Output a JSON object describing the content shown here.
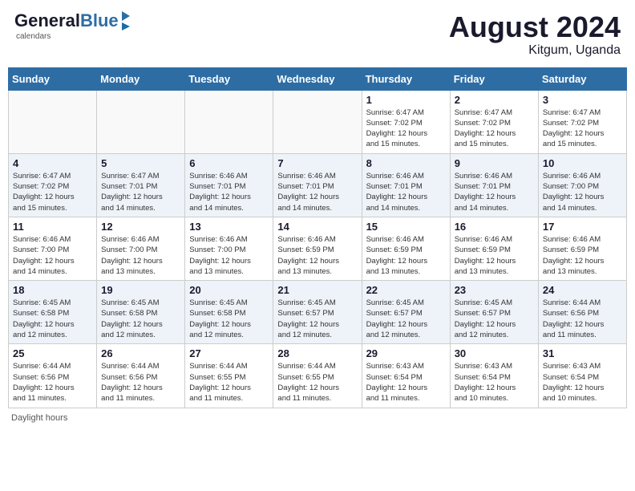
{
  "header": {
    "logo_general": "General",
    "logo_blue": "Blue",
    "month_year": "August 2024",
    "location": "Kitgum, Uganda"
  },
  "footer": {
    "daylight_label": "Daylight hours"
  },
  "days_of_week": [
    "Sunday",
    "Monday",
    "Tuesday",
    "Wednesday",
    "Thursday",
    "Friday",
    "Saturday"
  ],
  "weeks": [
    [
      {
        "day": "",
        "info": ""
      },
      {
        "day": "",
        "info": ""
      },
      {
        "day": "",
        "info": ""
      },
      {
        "day": "",
        "info": ""
      },
      {
        "day": "1",
        "info": "Sunrise: 6:47 AM\nSunset: 7:02 PM\nDaylight: 12 hours\nand 15 minutes."
      },
      {
        "day": "2",
        "info": "Sunrise: 6:47 AM\nSunset: 7:02 PM\nDaylight: 12 hours\nand 15 minutes."
      },
      {
        "day": "3",
        "info": "Sunrise: 6:47 AM\nSunset: 7:02 PM\nDaylight: 12 hours\nand 15 minutes."
      }
    ],
    [
      {
        "day": "4",
        "info": "Sunrise: 6:47 AM\nSunset: 7:02 PM\nDaylight: 12 hours\nand 15 minutes."
      },
      {
        "day": "5",
        "info": "Sunrise: 6:47 AM\nSunset: 7:01 PM\nDaylight: 12 hours\nand 14 minutes."
      },
      {
        "day": "6",
        "info": "Sunrise: 6:46 AM\nSunset: 7:01 PM\nDaylight: 12 hours\nand 14 minutes."
      },
      {
        "day": "7",
        "info": "Sunrise: 6:46 AM\nSunset: 7:01 PM\nDaylight: 12 hours\nand 14 minutes."
      },
      {
        "day": "8",
        "info": "Sunrise: 6:46 AM\nSunset: 7:01 PM\nDaylight: 12 hours\nand 14 minutes."
      },
      {
        "day": "9",
        "info": "Sunrise: 6:46 AM\nSunset: 7:01 PM\nDaylight: 12 hours\nand 14 minutes."
      },
      {
        "day": "10",
        "info": "Sunrise: 6:46 AM\nSunset: 7:00 PM\nDaylight: 12 hours\nand 14 minutes."
      }
    ],
    [
      {
        "day": "11",
        "info": "Sunrise: 6:46 AM\nSunset: 7:00 PM\nDaylight: 12 hours\nand 14 minutes."
      },
      {
        "day": "12",
        "info": "Sunrise: 6:46 AM\nSunset: 7:00 PM\nDaylight: 12 hours\nand 13 minutes."
      },
      {
        "day": "13",
        "info": "Sunrise: 6:46 AM\nSunset: 7:00 PM\nDaylight: 12 hours\nand 13 minutes."
      },
      {
        "day": "14",
        "info": "Sunrise: 6:46 AM\nSunset: 6:59 PM\nDaylight: 12 hours\nand 13 minutes."
      },
      {
        "day": "15",
        "info": "Sunrise: 6:46 AM\nSunset: 6:59 PM\nDaylight: 12 hours\nand 13 minutes."
      },
      {
        "day": "16",
        "info": "Sunrise: 6:46 AM\nSunset: 6:59 PM\nDaylight: 12 hours\nand 13 minutes."
      },
      {
        "day": "17",
        "info": "Sunrise: 6:46 AM\nSunset: 6:59 PM\nDaylight: 12 hours\nand 13 minutes."
      }
    ],
    [
      {
        "day": "18",
        "info": "Sunrise: 6:45 AM\nSunset: 6:58 PM\nDaylight: 12 hours\nand 12 minutes."
      },
      {
        "day": "19",
        "info": "Sunrise: 6:45 AM\nSunset: 6:58 PM\nDaylight: 12 hours\nand 12 minutes."
      },
      {
        "day": "20",
        "info": "Sunrise: 6:45 AM\nSunset: 6:58 PM\nDaylight: 12 hours\nand 12 minutes."
      },
      {
        "day": "21",
        "info": "Sunrise: 6:45 AM\nSunset: 6:57 PM\nDaylight: 12 hours\nand 12 minutes."
      },
      {
        "day": "22",
        "info": "Sunrise: 6:45 AM\nSunset: 6:57 PM\nDaylight: 12 hours\nand 12 minutes."
      },
      {
        "day": "23",
        "info": "Sunrise: 6:45 AM\nSunset: 6:57 PM\nDaylight: 12 hours\nand 12 minutes."
      },
      {
        "day": "24",
        "info": "Sunrise: 6:44 AM\nSunset: 6:56 PM\nDaylight: 12 hours\nand 11 minutes."
      }
    ],
    [
      {
        "day": "25",
        "info": "Sunrise: 6:44 AM\nSunset: 6:56 PM\nDaylight: 12 hours\nand 11 minutes."
      },
      {
        "day": "26",
        "info": "Sunrise: 6:44 AM\nSunset: 6:56 PM\nDaylight: 12 hours\nand 11 minutes."
      },
      {
        "day": "27",
        "info": "Sunrise: 6:44 AM\nSunset: 6:55 PM\nDaylight: 12 hours\nand 11 minutes."
      },
      {
        "day": "28",
        "info": "Sunrise: 6:44 AM\nSunset: 6:55 PM\nDaylight: 12 hours\nand 11 minutes."
      },
      {
        "day": "29",
        "info": "Sunrise: 6:43 AM\nSunset: 6:54 PM\nDaylight: 12 hours\nand 11 minutes."
      },
      {
        "day": "30",
        "info": "Sunrise: 6:43 AM\nSunset: 6:54 PM\nDaylight: 12 hours\nand 10 minutes."
      },
      {
        "day": "31",
        "info": "Sunrise: 6:43 AM\nSunset: 6:54 PM\nDaylight: 12 hours\nand 10 minutes."
      }
    ]
  ]
}
